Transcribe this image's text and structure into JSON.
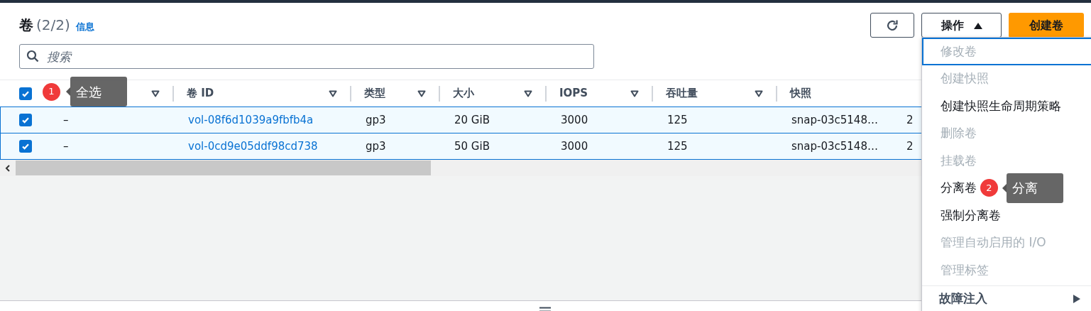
{
  "header": {
    "title": "卷",
    "count": "(2/2)",
    "info_link": "信息"
  },
  "toolbar": {
    "actions_button": "操作",
    "create_button": "创建卷"
  },
  "search": {
    "placeholder": "搜索"
  },
  "table": {
    "select_all": {
      "checked": true,
      "annotation": {
        "number": "1",
        "tooltip": "全选"
      }
    },
    "columns": [
      {
        "label": "卷 ID"
      },
      {
        "label": "类型"
      },
      {
        "label": "大小"
      },
      {
        "label": "IOPS"
      },
      {
        "label": "吞吐量"
      },
      {
        "label": "快照"
      }
    ],
    "rows": [
      {
        "selected": true,
        "name": "–",
        "volume_id": "vol-08f6d1039a9fbfb4a",
        "type": "gp3",
        "size": "20 GiB",
        "iops": "3000",
        "throughput": "125",
        "snapshot": "snap-03c5148…",
        "column_9": "2"
      },
      {
        "selected": true,
        "name": "–",
        "volume_id": "vol-0cd9e05ddf98cd738",
        "type": "gp3",
        "size": "50 GiB",
        "iops": "3000",
        "throughput": "125",
        "snapshot": "snap-03c5148…",
        "column_9": "2"
      }
    ]
  },
  "actions_menu": {
    "items": [
      {
        "kind": "item",
        "label": "修改卷",
        "disabled": true,
        "focused": true
      },
      {
        "kind": "item",
        "label": "创建快照",
        "disabled": true,
        "focused": false
      },
      {
        "kind": "item",
        "label": "创建快照生命周期策略",
        "disabled": false,
        "focused": false
      },
      {
        "kind": "item",
        "label": "删除卷",
        "disabled": true,
        "focused": false
      },
      {
        "kind": "item",
        "label": "挂载卷",
        "disabled": true,
        "focused": false
      },
      {
        "kind": "item",
        "label": "分离卷",
        "disabled": false,
        "focused": false,
        "annotation": {
          "number": "2",
          "tooltip": "分离"
        }
      },
      {
        "kind": "item",
        "label": "强制分离卷",
        "disabled": false,
        "focused": false
      },
      {
        "kind": "item",
        "label": "管理自动启用的 I/O",
        "disabled": true,
        "focused": false
      },
      {
        "kind": "item",
        "label": "管理标签",
        "disabled": true,
        "focused": false
      },
      {
        "kind": "submenu",
        "label": "故障注入",
        "disabled": false,
        "focused": false
      }
    ]
  }
}
